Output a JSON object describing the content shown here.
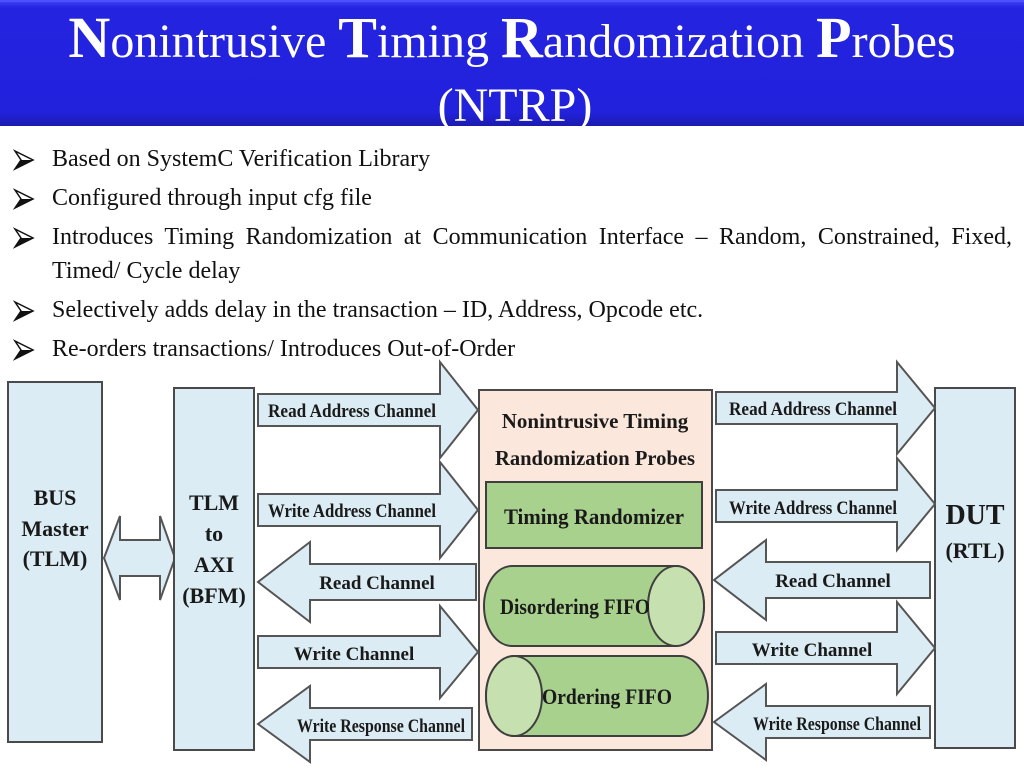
{
  "slide": {
    "title": {
      "words": [
        {
          "cap": "N",
          "rest": "onintrusive "
        },
        {
          "cap": "T",
          "rest": "iming "
        },
        {
          "cap": "R",
          "rest": "andomization "
        },
        {
          "cap": "P",
          "rest": "robes"
        }
      ],
      "acronym": "(NTRP)"
    },
    "bullets": [
      "Based on SystemC Verification Library",
      "Configured through input cfg file",
      "Introduces Timing Randomization at Communication Interface – Random, Constrained, Fixed, Timed/ Cycle delay",
      "Selectively adds delay in the transaction – ID, Address, Opcode etc.",
      "Re-orders transactions/ Introduces Out-of-Order"
    ],
    "bullet_icon": "arrowhead-bullet-icon"
  },
  "diagram": {
    "bus_master": {
      "lines": [
        "BUS",
        "Master",
        "(TLM)"
      ]
    },
    "bfm": {
      "lines": [
        "TLM",
        "to",
        "AXI",
        "(BFM)"
      ]
    },
    "ntrp_block": {
      "title_lines": [
        "Nonintrusive Timing",
        "Randomization Probes"
      ],
      "timing_randomizer": "Timing Randomizer",
      "disordering_fifo": "Disordering FIFO",
      "ordering_fifo": "Ordering FIFO"
    },
    "dut": {
      "lines": [
        "DUT",
        "(RTL)"
      ]
    },
    "channels_left": [
      {
        "label": "Read Address Channel",
        "direction": "right"
      },
      {
        "label": "Write Address Channel",
        "direction": "right"
      },
      {
        "label": "Read Channel",
        "direction": "left"
      },
      {
        "label": "Write Channel",
        "direction": "right"
      },
      {
        "label": "Write Response Channel",
        "direction": "left"
      }
    ],
    "channels_right": [
      {
        "label": "Read Address Channel",
        "direction": "right"
      },
      {
        "label": "Write Address Channel",
        "direction": "right"
      },
      {
        "label": "Read Channel",
        "direction": "left"
      },
      {
        "label": "Write Channel",
        "direction": "right"
      },
      {
        "label": "Write Response Channel",
        "direction": "left"
      }
    ],
    "colors": {
      "block_fill": "#dbecf4",
      "ntrp_fill": "#fbe7dc",
      "green_fill": "#a9d18e",
      "green_light": "#c7e0b0",
      "outline": "#4a4a4a",
      "title_blue": "#2222dd"
    }
  }
}
